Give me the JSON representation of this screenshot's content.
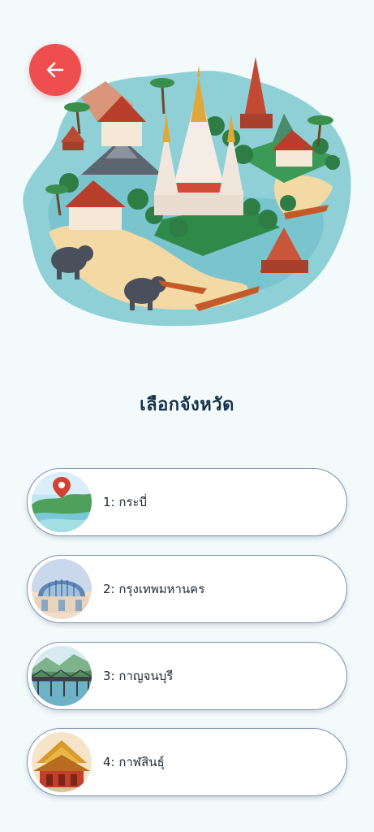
{
  "header": {
    "back_icon": "arrow-left-icon",
    "back_color": "#ef4e4e"
  },
  "page": {
    "title": "เลือกจังหวัด"
  },
  "provinces": [
    {
      "label": "1: กระบี่",
      "thumb_icon": "krabi-location-pin-thumbnail"
    },
    {
      "label": "2: กรุงเทพมหานคร",
      "thumb_icon": "bangkok-station-thumbnail"
    },
    {
      "label": "3: กาญจนบุรี",
      "thumb_icon": "kanchanaburi-bridge-thumbnail"
    },
    {
      "label": "4: กาฬสินธุ์",
      "thumb_icon": "kalasin-temple-thumbnail"
    }
  ],
  "colors": {
    "accent": "#ef4e4e",
    "title": "#16324a",
    "card_border": "#7c93b2",
    "background": "#f2fafb"
  }
}
